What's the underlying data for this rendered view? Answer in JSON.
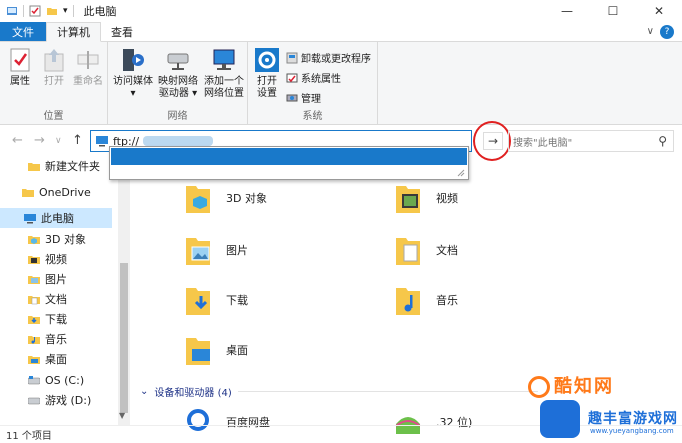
{
  "titlebar": {
    "title": "此电脑",
    "dropdown_glyph": "▾",
    "buttons": {
      "minimize": "—",
      "maximize": "☐",
      "close": "✕"
    }
  },
  "tabs": [
    {
      "label": "文件"
    },
    {
      "label": "计算机"
    },
    {
      "label": "查看"
    }
  ],
  "help_glyph": "?",
  "collapse_glyph": "∨",
  "ribbon": {
    "groups": [
      {
        "label": "位置",
        "buttons": [
          {
            "label": "属性"
          },
          {
            "label": "打开"
          },
          {
            "label": "重命名"
          }
        ]
      },
      {
        "label": "网络",
        "buttons": [
          {
            "label": "访问媒体",
            "sub": "▾"
          },
          {
            "label": "映射网络",
            "sub": "驱动器 ▾"
          },
          {
            "label": "添加一个",
            "sub": "网络位置"
          }
        ]
      },
      {
        "label": "系统",
        "buttons": [
          {
            "label": "打开",
            "sub": "设置"
          }
        ],
        "small": [
          {
            "label": "卸载或更改程序"
          },
          {
            "label": "系统属性"
          },
          {
            "label": "管理"
          }
        ]
      }
    ]
  },
  "addressbar": {
    "nav": {
      "back": "←",
      "forward": "→",
      "recent": "∨",
      "up": "↑"
    },
    "value": "ftp://",
    "go_glyph": "→",
    "search_placeholder": "搜索\"此电脑\"",
    "search_glyph": "⚲"
  },
  "navpane": {
    "items": [
      {
        "label": "新建文件夹",
        "icon": "folder-icon"
      },
      {
        "label": "OneDrive",
        "icon": "cloud-icon"
      },
      {
        "label": "此电脑",
        "icon": "pc-icon"
      },
      {
        "label": "3D 对象",
        "icon": "3d-icon"
      },
      {
        "label": "视频",
        "icon": "video-icon"
      },
      {
        "label": "图片",
        "icon": "picture-icon"
      },
      {
        "label": "文档",
        "icon": "document-icon"
      },
      {
        "label": "下载",
        "icon": "download-icon"
      },
      {
        "label": "音乐",
        "icon": "music-icon"
      },
      {
        "label": "桌面",
        "icon": "desktop-icon"
      },
      {
        "label": "OS (C:)",
        "icon": "drive-icon"
      },
      {
        "label": "游戏 (D:)",
        "icon": "drive-icon"
      }
    ]
  },
  "content": {
    "folders": [
      {
        "label": "3D 对象"
      },
      {
        "label": "视频"
      },
      {
        "label": "图片"
      },
      {
        "label": "文档"
      },
      {
        "label": "下载"
      },
      {
        "label": "音乐"
      },
      {
        "label": "桌面"
      }
    ],
    "devices_header": "设备和驱动器 (4)",
    "devices": [
      {
        "label": "百度网盘"
      },
      {
        "label": ".32 位)"
      }
    ]
  },
  "status": {
    "text": "11 个项目"
  },
  "watermark": {
    "line1": "酷知网",
    "line2": "趣丰富游戏网",
    "line3": "www.yueyangbang.com"
  },
  "colors": {
    "accent": "#1979ca",
    "selected": "#cce8ff",
    "folder": "#f6c74a",
    "annotation": "#e02020"
  }
}
